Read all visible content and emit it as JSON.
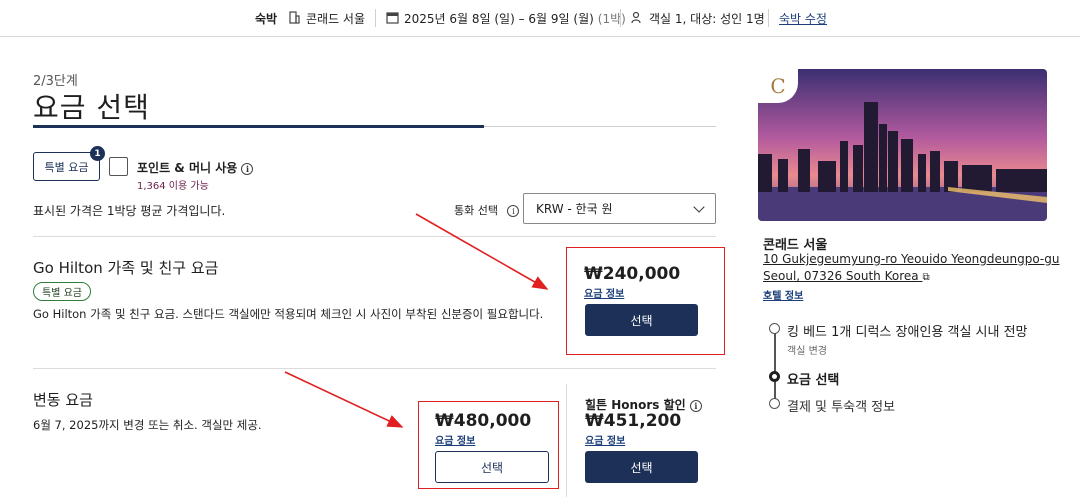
{
  "topbar": {
    "section": "숙박",
    "hotel": "콘래드 서울",
    "dates": "2025년 6월 8일 (일) – 6월 9일 (월)",
    "nights": "(1박)",
    "guests": "객실 1, 대상: 성인 1명",
    "edit_link": "숙박 수정",
    "icons": [
      "hotel-icon",
      "calendar-icon",
      "person-icon"
    ]
  },
  "header": {
    "step": "2/3단계",
    "title": "요금 선택",
    "progress": 0.66
  },
  "filters": {
    "special_rates_label": "특별 요금",
    "special_rates_count": "1",
    "points_label": "포인트 & 머니 사용",
    "points_available": "1,364 이용 가능",
    "points_checked": false
  },
  "pricing_note": "표시된 가격은 1박당 평균 가격입니다.",
  "currency": {
    "label": "통화 선택",
    "selected": "KRW - 한국 원"
  },
  "rates": [
    {
      "name": "Go Hilton 가족 및 친구 요금",
      "tag": "특별 요금",
      "description": "Go Hilton 가족 및 친구 요금. 스탠다드 객실에만 적용되며 체크인 시 사진이 부착된 신분증이 필요합니다.",
      "price": "₩240,000",
      "price_link": "요금 정보",
      "button": "선택"
    },
    {
      "name": "변동 요금",
      "description": "6월 7, 2025까지 변경 또는 취소. 객실만 제공.",
      "price": "₩480,000",
      "price_link": "요금 정보",
      "button": "선택",
      "honors_label": "힐튼 Honors 할인",
      "honors_price": "₩451,200",
      "honors_link": "요금 정보",
      "honors_button": "선택"
    }
  ],
  "sidebar": {
    "logo_letter": "C",
    "hotel_name": "콘래드 서울",
    "address_line1": "10 Gukjegeumyung-ro Yeouido Yeongdeungpo-gu",
    "address_line2": "Seoul, 07326 South Korea",
    "hotel_info_link": "호텔 정보",
    "steps": [
      {
        "label": "킹 베드 1개 디럭스 장애인용 객실 시내 전망",
        "sub": "객실 변경",
        "state": "done"
      },
      {
        "label": "요금 선택",
        "state": "active"
      },
      {
        "label": "결제 및 투숙객 정보",
        "state": "pending"
      }
    ]
  },
  "colors": {
    "navy": "#1c3058",
    "annotation_red": "#e02020",
    "tag_green": "#2f7d3a",
    "points_purple": "#6b1e4a"
  }
}
